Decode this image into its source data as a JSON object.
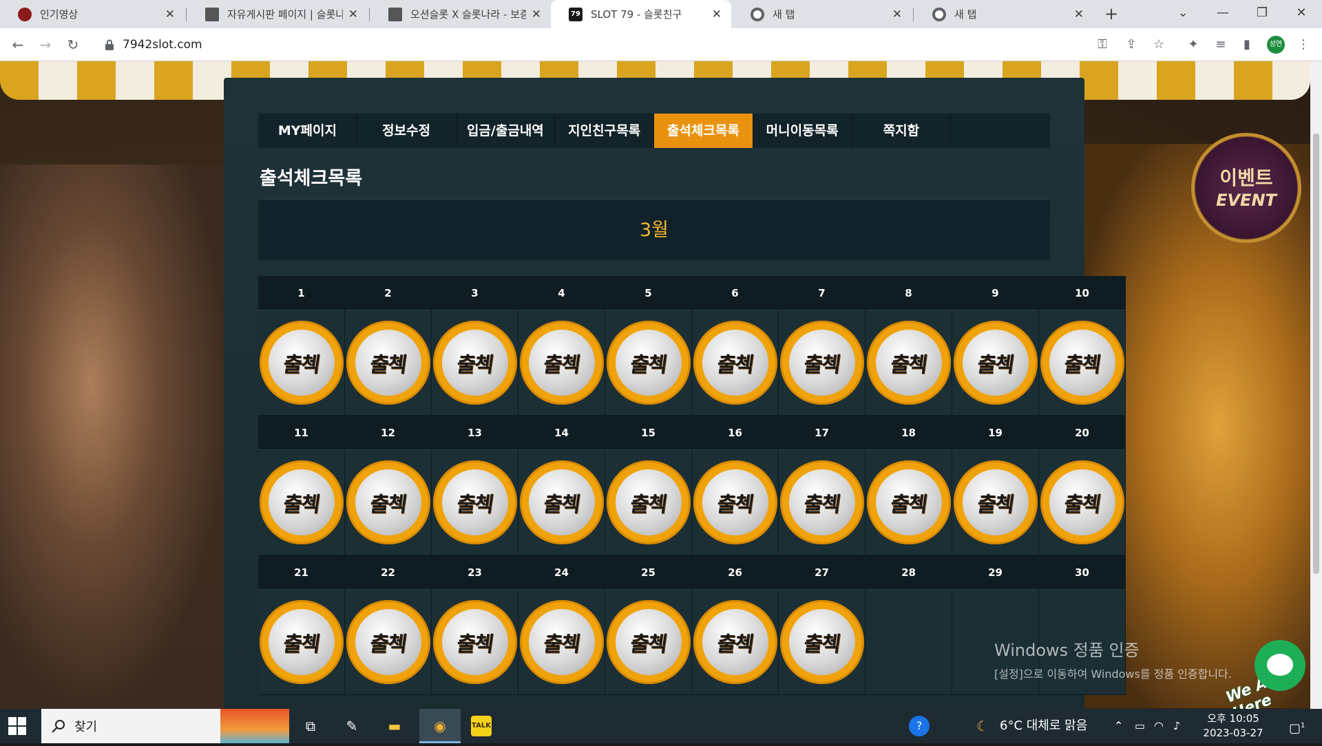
{
  "browser": {
    "tabs": [
      {
        "title": "인기영상",
        "favicon_color": "#8b1a1a"
      },
      {
        "title": "자유게시판 페이지 | 슬롯나",
        "favicon_color": "#555555"
      },
      {
        "title": "오션슬롯 X 슬롯나라 - 보증",
        "favicon_color": "#555555"
      },
      {
        "title": "SLOT 79 - 슬롯친구",
        "favicon_color": "#1a1a1a",
        "favicon_text": "79"
      },
      {
        "title": "새 탭",
        "favicon_color": "#5f6368"
      },
      {
        "title": "새 탭",
        "favicon_color": "#5f6368"
      }
    ],
    "active_tab_index": 3,
    "url": "7942slot.com",
    "profile_label": "성연"
  },
  "site": {
    "menu": [
      {
        "label": "MY페이지"
      },
      {
        "label": "정보수정"
      },
      {
        "label": "입금/출금내역"
      },
      {
        "label": "지인친구목록"
      },
      {
        "label": "출석체크목록"
      },
      {
        "label": "머니이동목록"
      },
      {
        "label": "쪽지함"
      },
      {
        "label": ""
      }
    ],
    "active_menu_index": 4,
    "page_title": "출석체크목록",
    "month": "3월",
    "stamp_label": "출첵",
    "event_badge": {
      "korean": "이벤트",
      "english": "EVENT"
    },
    "chat_label": "We Are Here"
  },
  "calendar": {
    "days": [
      1,
      2,
      3,
      4,
      5,
      6,
      7,
      8,
      9,
      10,
      11,
      12,
      13,
      14,
      15,
      16,
      17,
      18,
      19,
      20,
      21,
      22,
      23,
      24,
      25,
      26,
      27,
      28,
      29,
      30
    ],
    "attended_through": 27
  },
  "windows_watermark": {
    "line1": "Windows 정품 인증",
    "line2": "[설정]으로 이동하여 Windows를 정품 인증합니다."
  },
  "taskbar": {
    "search_label": "찾기",
    "weather": "6°C  대체로 맑음",
    "time": "오후 10:05",
    "date": "2023-03-27",
    "notification_count": "1"
  }
}
